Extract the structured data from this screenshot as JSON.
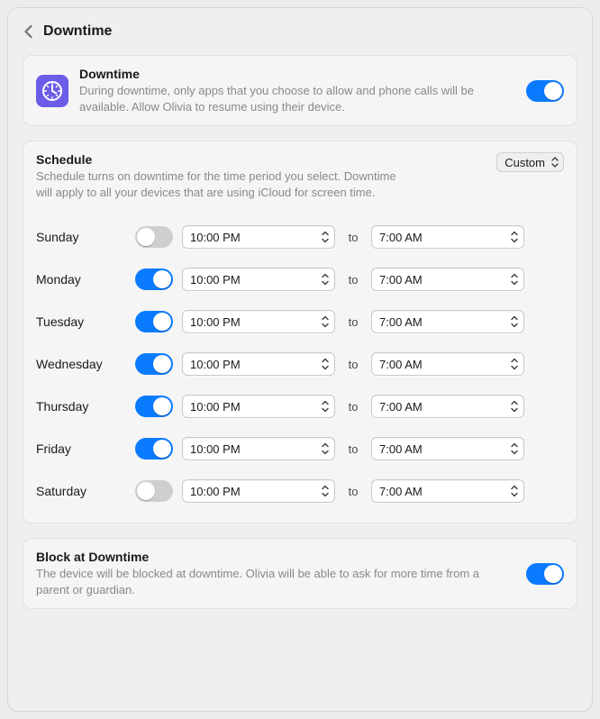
{
  "header": {
    "title": "Downtime"
  },
  "master": {
    "title": "Downtime",
    "description": "During downtime, only apps that you choose to allow and phone calls will be available. Allow Olivia to resume using their device.",
    "enabled": true
  },
  "schedule": {
    "title": "Schedule",
    "description": "Schedule turns on downtime for the time period you select. Downtime will apply to all your devices that are using iCloud for screen time.",
    "mode_label": "Custom",
    "to_label": "to",
    "days": [
      {
        "name": "Sunday",
        "enabled": false,
        "from": "10:00 PM",
        "to": "7:00 AM"
      },
      {
        "name": "Monday",
        "enabled": true,
        "from": "10:00 PM",
        "to": "7:00 AM"
      },
      {
        "name": "Tuesday",
        "enabled": true,
        "from": "10:00 PM",
        "to": "7:00 AM"
      },
      {
        "name": "Wednesday",
        "enabled": true,
        "from": "10:00 PM",
        "to": "7:00 AM"
      },
      {
        "name": "Thursday",
        "enabled": true,
        "from": "10:00 PM",
        "to": "7:00 AM"
      },
      {
        "name": "Friday",
        "enabled": true,
        "from": "10:00 PM",
        "to": "7:00 AM"
      },
      {
        "name": "Saturday",
        "enabled": false,
        "from": "10:00 PM",
        "to": "7:00 AM"
      }
    ]
  },
  "block": {
    "title": "Block at Downtime",
    "description": "The device will be blocked at downtime. Olivia will be able to ask for more time from a parent or guardian.",
    "enabled": true
  }
}
